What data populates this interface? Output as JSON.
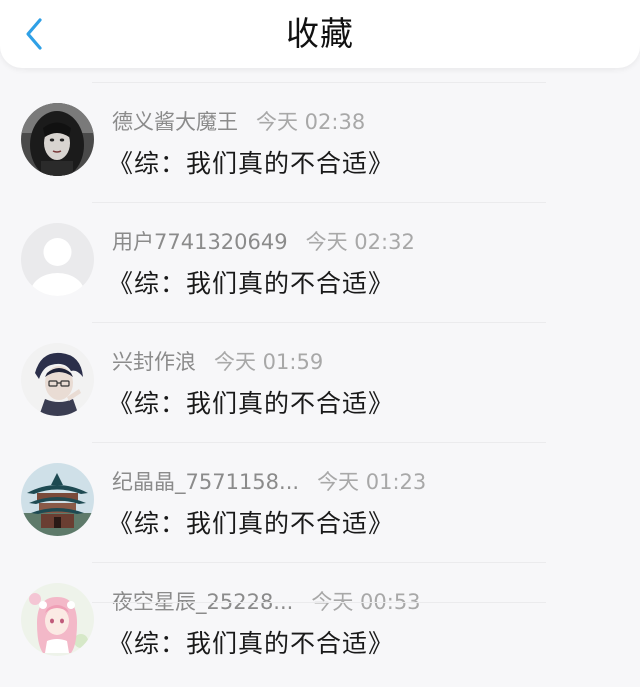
{
  "header": {
    "title": "收藏",
    "back_icon": "chevron-left-icon",
    "accent_color": "#2fa0e6"
  },
  "items": [
    {
      "username": "德义酱大魔王",
      "time": "今天 02:38",
      "book": "《综：我们真的不合适》",
      "avatar": "avatar-dark-hair-girl"
    },
    {
      "username": "用户7741320649",
      "time": "今天 02:32",
      "book": "《综：我们真的不合适》",
      "avatar": "avatar-default-placeholder"
    },
    {
      "username": "兴封作浪",
      "time": "今天 01:59",
      "book": "《综：我们真的不合适》",
      "avatar": "avatar-anime-boy-glasses"
    },
    {
      "username": "纪晶晶_7571158...",
      "time": "今天 01:23",
      "book": "《综：我们真的不合适》",
      "avatar": "avatar-pagoda-building"
    },
    {
      "username": "夜空星辰_25228...",
      "time": "今天 00:53",
      "book": "《综：我们真的不合适》",
      "avatar": "avatar-pink-anime-girl"
    }
  ]
}
